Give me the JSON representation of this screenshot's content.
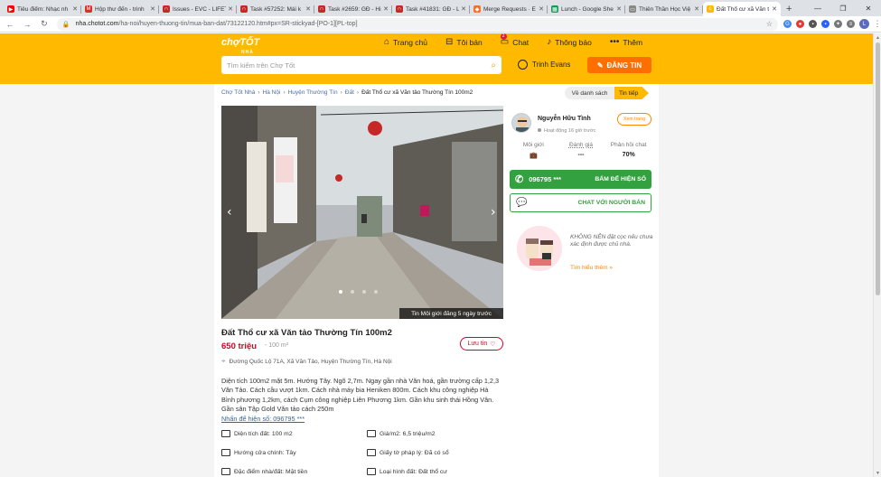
{
  "browser": {
    "tabs": [
      {
        "title": "Tiêu điểm: Nhạc nh",
        "icon_color": "#ff0000",
        "icon": "youtube-icon",
        "glyph": "▶"
      },
      {
        "title": "Hộp thư đến - trinh",
        "icon_color": "#d93025",
        "icon": "gmail-icon",
        "glyph": "M"
      },
      {
        "title": "Issues - EVC - LIFET",
        "icon_color": "#c62828",
        "icon": "headset-icon",
        "glyph": "∩"
      },
      {
        "title": "Task #57252: Mái k",
        "icon_color": "#c62828",
        "icon": "headset-icon",
        "glyph": "∩"
      },
      {
        "title": "Task #2659: GĐ - Hi",
        "icon_color": "#c62828",
        "icon": "headset-icon",
        "glyph": "∩"
      },
      {
        "title": "Task #41831: GĐ - L",
        "icon_color": "#c62828",
        "icon": "headset-icon",
        "glyph": "∩"
      },
      {
        "title": "Merge Requests · E",
        "icon_color": "#fc6d26",
        "icon": "gitlab-icon",
        "glyph": "◆"
      },
      {
        "title": "Lunch - Google She",
        "icon_color": "#0f9d58",
        "icon": "sheets-icon",
        "glyph": "▦"
      },
      {
        "title": "Thiên Thần Học Việ",
        "icon_color": "#888888",
        "icon": "document-icon",
        "glyph": "▭"
      },
      {
        "title": "Đất Thổ cư xã Văn t",
        "icon_color": "#ffba00",
        "icon": "chotot-icon",
        "glyph": "c",
        "active": true
      }
    ],
    "url_host": "nha.chotot.com",
    "url_path": "/ha-noi/huyen-thuong-tin/mua-ban-dat/73122120.htm#px=SR-stickyad-[PO-1][PL-top]"
  },
  "header": {
    "logo_text": "chợTỐT",
    "logo_sub": "NHÀ",
    "nav": [
      {
        "label": "Trang chủ",
        "icon": "home-icon",
        "glyph": "⌂"
      },
      {
        "label": "Tôi bán",
        "icon": "basket-icon",
        "glyph": "⊟"
      },
      {
        "label": "Chat",
        "icon": "chat-icon",
        "glyph": "▭",
        "badge": "2"
      },
      {
        "label": "Thông báo",
        "icon": "bell-icon",
        "glyph": "♪"
      },
      {
        "label": "Thêm",
        "icon": "more-icon",
        "glyph": "•••"
      }
    ],
    "search_placeholder": "Tìm kiếm trên Chợ Tốt",
    "user_name": "Trinh Evans",
    "post_label": "ĐĂNG TIN"
  },
  "breadcrumb": [
    "Chợ Tốt Nhà",
    "Hà Nội",
    "Huyện Thường Tín",
    "Đất",
    "Đất Thổ cư xã Văn tảo Thường Tín 100m2"
  ],
  "nav_pills": {
    "back": "Về danh sách",
    "next": "Tin tiếp"
  },
  "photo": {
    "caption": "Tin Môi giới đăng 5 ngày trước",
    "dots": 4,
    "active_dot": 0
  },
  "listing": {
    "title": "Đất Thổ cư xã Văn tảo Thường Tín 100m2",
    "price": "650 triệu",
    "area": "- 100 m²",
    "save_label": "Lưu tin",
    "address": "Đường Quốc Lộ 71A, Xã Văn Tảo, Huyện Thường Tín, Hà Nội",
    "description": "Diện tích 100m2 mặt 5m. Hướng Tây. Ngõ 2,7m. Ngay gần nhà Văn hoá, gần trường cấp 1,2,3 Văn Tảo. Cách cầu vượt 1km. Cách nhà máy bia Heniken 800m. Cách khu công nghiệp Hà Bình phương 1,2km, cách Cụm công nghiệp Liên Phương 1km. Gần khu sinh thái Hồng Vân. Gần sân Tập Gold Văn tảo cách 250m",
    "phone_link": "Nhấn để hiện số: 096795 ***",
    "attributes": [
      {
        "label": "Diện tích đất: 100 m2",
        "icon": "area-icon"
      },
      {
        "label": "Giá/m2: 6,5 triệu/m2",
        "icon": "price-per-m2-icon"
      },
      {
        "label": "Hướng cửa chính: Tây",
        "icon": "compass-icon"
      },
      {
        "label": "Giấy tờ pháp lý: Đã có sổ",
        "icon": "document-icon"
      },
      {
        "label": "Đặc điểm nhà/đất: Mặt tiền",
        "icon": "house-icon"
      },
      {
        "label": "Loại hình đất: Đất thổ cư",
        "icon": "land-type-icon"
      }
    ]
  },
  "seller": {
    "name": "Nguyễn Hữu Tình",
    "status": "Hoạt động 16 giờ trước",
    "view_page": "Xem trang",
    "stats": [
      {
        "label": "Môi giới",
        "value": "💼"
      },
      {
        "label": "Đánh giá",
        "value": "---"
      },
      {
        "label": "Phản hồi chat",
        "value": "70%"
      }
    ],
    "call_number": "096795 ***",
    "call_action": "BẤM ĐỂ HIỆN SỐ",
    "chat_label": "CHAT VỚI NGƯỜI BÁN",
    "safety_text": "KHÔNG NÊN đặt cọc nếu chưa xác định được chủ nhà.",
    "safety_link": "Tìm hiểu thêm »"
  }
}
